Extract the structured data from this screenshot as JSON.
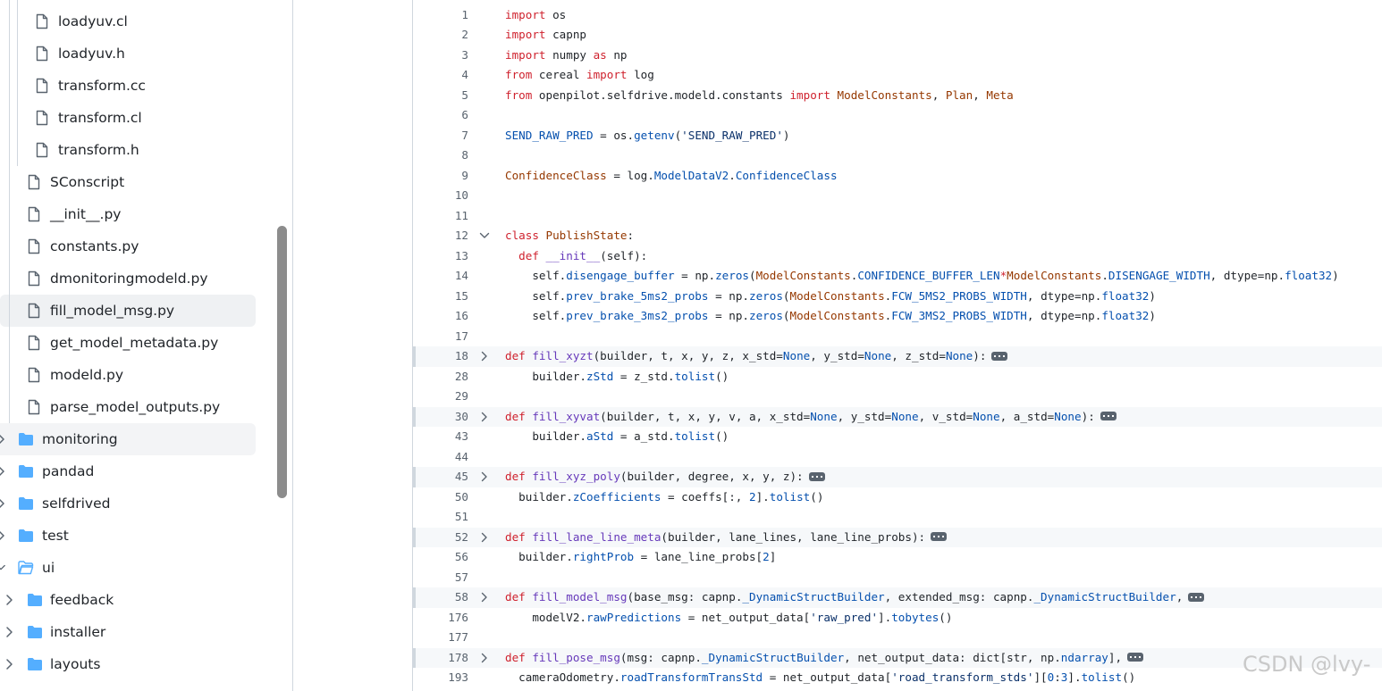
{
  "colors": {
    "folder": "#54aeff",
    "keyword": "#cf222e",
    "function": "#6639ba",
    "entity": "#0550ae",
    "class": "#953800",
    "string": "#0a3069"
  },
  "sidebar": {
    "items": [
      {
        "label": "loadyuv.cl",
        "type": "file",
        "depth": 2
      },
      {
        "label": "loadyuv.h",
        "type": "file",
        "depth": 2
      },
      {
        "label": "transform.cc",
        "type": "file",
        "depth": 2
      },
      {
        "label": "transform.cl",
        "type": "file",
        "depth": 2
      },
      {
        "label": "transform.h",
        "type": "file",
        "depth": 2
      },
      {
        "label": "SConscript",
        "type": "file",
        "depth": 1
      },
      {
        "label": "__init__.py",
        "type": "file",
        "depth": 1
      },
      {
        "label": "constants.py",
        "type": "file",
        "depth": 1
      },
      {
        "label": "dmonitoringmodeld.py",
        "type": "file",
        "depth": 1
      },
      {
        "label": "fill_model_msg.py",
        "type": "file",
        "depth": 1,
        "selected": true
      },
      {
        "label": "get_model_metadata.py",
        "type": "file",
        "depth": 1
      },
      {
        "label": "modeld.py",
        "type": "file",
        "depth": 1
      },
      {
        "label": "parse_model_outputs.py",
        "type": "file",
        "depth": 1
      },
      {
        "label": "monitoring",
        "type": "folder",
        "depth": 0,
        "hover": true
      },
      {
        "label": "pandad",
        "type": "folder",
        "depth": 0
      },
      {
        "label": "selfdrived",
        "type": "folder",
        "depth": 0
      },
      {
        "label": "test",
        "type": "folder",
        "depth": 0
      },
      {
        "label": "ui",
        "type": "folder-open",
        "depth": 0
      },
      {
        "label": "feedback",
        "type": "folder",
        "depth": 1
      },
      {
        "label": "installer",
        "type": "folder",
        "depth": 1
      },
      {
        "label": "layouts",
        "type": "folder",
        "depth": 1
      }
    ]
  },
  "code": {
    "lines": [
      {
        "n": "1",
        "t": [
          [
            "kw",
            "import"
          ],
          [
            "",
            "os"
          ]
        ]
      },
      {
        "n": "2",
        "t": [
          [
            "kw",
            "import"
          ],
          [
            "",
            "capnp"
          ]
        ]
      },
      {
        "n": "3",
        "t": [
          [
            "kw",
            "import"
          ],
          [
            "",
            "numpy "
          ],
          [
            "kw",
            "as"
          ],
          [
            "",
            "np"
          ]
        ]
      },
      {
        "n": "4",
        "t": [
          [
            "kw",
            "from"
          ],
          [
            "",
            "cereal "
          ],
          [
            "kw",
            "import"
          ],
          [
            "",
            "log"
          ]
        ]
      },
      {
        "n": "5",
        "t": [
          [
            "kw",
            "from"
          ],
          [
            "",
            "openpilot.selfdrive.modeld.constants "
          ],
          [
            "kw",
            "import"
          ],
          [
            "cls",
            "ModelConstants"
          ],
          [
            "",
            ", "
          ],
          [
            "cls",
            "Plan"
          ],
          [
            "",
            ", "
          ],
          [
            "cls",
            "Meta"
          ]
        ]
      },
      {
        "n": "6",
        "t": []
      },
      {
        "n": "7",
        "t": [
          [
            "ent",
            "SEND_RAW_PRED"
          ],
          [
            "",
            " = os."
          ],
          [
            "ent",
            "getenv"
          ],
          [
            "",
            "("
          ],
          [
            "str",
            "'SEND_RAW_PRED'"
          ],
          [
            "",
            ")"
          ]
        ]
      },
      {
        "n": "8",
        "t": []
      },
      {
        "n": "9",
        "t": [
          [
            "cls",
            "ConfidenceClass"
          ],
          [
            "",
            " = log."
          ],
          [
            "ent",
            "ModelDataV2"
          ],
          [
            "",
            "."
          ],
          [
            "ent",
            "ConfidenceClass"
          ]
        ]
      },
      {
        "n": "10",
        "t": []
      },
      {
        "n": "11",
        "t": []
      },
      {
        "n": "12",
        "fold": "open",
        "t": [
          [
            "kw",
            "class"
          ],
          [
            "cls",
            "PublishState"
          ],
          [
            "",
            ":"
          ]
        ]
      },
      {
        "n": "13",
        "t": [
          [
            "",
            "  "
          ],
          [
            "kw",
            "def"
          ],
          [
            "fn",
            "__init__"
          ],
          [
            "",
            "(self):"
          ]
        ]
      },
      {
        "n": "14",
        "t": [
          [
            "",
            "    self."
          ],
          [
            "ent",
            "disengage_buffer"
          ],
          [
            "",
            " = np."
          ],
          [
            "ent",
            "zeros"
          ],
          [
            "",
            "("
          ],
          [
            "cls",
            "ModelConstants"
          ],
          [
            "",
            "."
          ],
          [
            "ent",
            "CONFIDENCE_BUFFER_LEN"
          ],
          [
            "kw",
            "*"
          ],
          [
            "cls",
            "ModelConstants"
          ],
          [
            "",
            "."
          ],
          [
            "ent",
            "DISENGAGE_WIDTH"
          ],
          [
            "",
            ", dtype=np."
          ],
          [
            "ent",
            "float32"
          ],
          [
            "",
            ")"
          ]
        ]
      },
      {
        "n": "15",
        "t": [
          [
            "",
            "    self."
          ],
          [
            "ent",
            "prev_brake_5ms2_probs"
          ],
          [
            "",
            " = np."
          ],
          [
            "ent",
            "zeros"
          ],
          [
            "",
            "("
          ],
          [
            "cls",
            "ModelConstants"
          ],
          [
            "",
            "."
          ],
          [
            "ent",
            "FCW_5MS2_PROBS_WIDTH"
          ],
          [
            "",
            ", dtype=np."
          ],
          [
            "ent",
            "float32"
          ],
          [
            "",
            ")"
          ]
        ]
      },
      {
        "n": "16",
        "t": [
          [
            "",
            "    self."
          ],
          [
            "ent",
            "prev_brake_3ms2_probs"
          ],
          [
            "",
            " = np."
          ],
          [
            "ent",
            "zeros"
          ],
          [
            "",
            "("
          ],
          [
            "cls",
            "ModelConstants"
          ],
          [
            "",
            "."
          ],
          [
            "ent",
            "FCW_3MS2_PROBS_WIDTH"
          ],
          [
            "",
            ", dtype=np."
          ],
          [
            "ent",
            "float32"
          ],
          [
            "",
            ")"
          ]
        ]
      },
      {
        "n": "17",
        "t": []
      },
      {
        "n": "18",
        "fold": "closed",
        "t": [
          [
            "kw",
            "def"
          ],
          [
            "fn",
            "fill_xyzt"
          ],
          [
            "",
            "(builder, t, x, y, z, x_std="
          ],
          [
            "ent",
            "None"
          ],
          [
            "",
            ", y_std="
          ],
          [
            "ent",
            "None"
          ],
          [
            "",
            ", z_std="
          ],
          [
            "ent",
            "None"
          ],
          [
            "",
            "):"
          ]
        ]
      },
      {
        "n": "28",
        "t": [
          [
            "",
            "    builder."
          ],
          [
            "ent",
            "zStd"
          ],
          [
            "",
            " = z_std."
          ],
          [
            "ent",
            "tolist"
          ],
          [
            "",
            "()"
          ]
        ]
      },
      {
        "n": "29",
        "t": []
      },
      {
        "n": "30",
        "fold": "closed",
        "t": [
          [
            "kw",
            "def"
          ],
          [
            "fn",
            "fill_xyvat"
          ],
          [
            "",
            "(builder, t, x, y, v, a, x_std="
          ],
          [
            "ent",
            "None"
          ],
          [
            "",
            ", y_std="
          ],
          [
            "ent",
            "None"
          ],
          [
            "",
            ", v_std="
          ],
          [
            "ent",
            "None"
          ],
          [
            "",
            ", a_std="
          ],
          [
            "ent",
            "None"
          ],
          [
            "",
            "):"
          ]
        ]
      },
      {
        "n": "43",
        "t": [
          [
            "",
            "    builder."
          ],
          [
            "ent",
            "aStd"
          ],
          [
            "",
            " = a_std."
          ],
          [
            "ent",
            "tolist"
          ],
          [
            "",
            "()"
          ]
        ]
      },
      {
        "n": "44",
        "t": []
      },
      {
        "n": "45",
        "fold": "closed",
        "t": [
          [
            "kw",
            "def"
          ],
          [
            "fn",
            "fill_xyz_poly"
          ],
          [
            "",
            "(builder, degree, x, y, z):"
          ]
        ]
      },
      {
        "n": "50",
        "t": [
          [
            "",
            "  builder."
          ],
          [
            "ent",
            "zCoefficients"
          ],
          [
            "",
            " = coeffs[:, "
          ],
          [
            "num",
            "2"
          ],
          [
            "",
            "]."
          ],
          [
            "ent",
            "tolist"
          ],
          [
            "",
            "()"
          ]
        ]
      },
      {
        "n": "51",
        "t": []
      },
      {
        "n": "52",
        "fold": "closed",
        "t": [
          [
            "kw",
            "def"
          ],
          [
            "fn",
            "fill_lane_line_meta"
          ],
          [
            "",
            "(builder, lane_lines, lane_line_probs):"
          ]
        ]
      },
      {
        "n": "56",
        "t": [
          [
            "",
            "  builder."
          ],
          [
            "ent",
            "rightProb"
          ],
          [
            "",
            " = lane_line_probs["
          ],
          [
            "num",
            "2"
          ],
          [
            "",
            "]"
          ]
        ]
      },
      {
        "n": "57",
        "t": []
      },
      {
        "n": "58",
        "fold": "closed",
        "t": [
          [
            "kw",
            "def"
          ],
          [
            "fn",
            "fill_model_msg"
          ],
          [
            "",
            "(base_msg: capnp."
          ],
          [
            "ent",
            "_DynamicStructBuilder"
          ],
          [
            "",
            ", extended_msg: capnp."
          ],
          [
            "ent",
            "_DynamicStructBuilder"
          ],
          [
            "",
            ","
          ]
        ]
      },
      {
        "n": "176",
        "t": [
          [
            "",
            "    modelV2."
          ],
          [
            "ent",
            "rawPredictions"
          ],
          [
            "",
            " = net_output_data["
          ],
          [
            "str",
            "'raw_pred'"
          ],
          [
            "",
            "]."
          ],
          [
            "ent",
            "tobytes"
          ],
          [
            "",
            "()"
          ]
        ]
      },
      {
        "n": "177",
        "t": []
      },
      {
        "n": "178",
        "fold": "closed",
        "t": [
          [
            "kw",
            "def"
          ],
          [
            "fn",
            "fill_pose_msg"
          ],
          [
            "",
            "(msg: capnp."
          ],
          [
            "ent",
            "_DynamicStructBuilder"
          ],
          [
            "",
            ", net_output_data: dict[str, np."
          ],
          [
            "ent",
            "ndarray"
          ],
          [
            "",
            "],"
          ]
        ]
      },
      {
        "n": "193",
        "t": [
          [
            "",
            "  cameraOdometry."
          ],
          [
            "ent",
            "roadTransformTransStd"
          ],
          [
            "",
            " = net_output_data["
          ],
          [
            "str",
            "'road_transform_stds'"
          ],
          [
            "",
            "]["
          ],
          [
            "num",
            "0"
          ],
          [
            "",
            ":"
          ],
          [
            "num",
            "3"
          ],
          [
            "",
            "]."
          ],
          [
            "ent",
            "tolist"
          ],
          [
            "",
            "()"
          ]
        ]
      }
    ]
  },
  "watermark": "CSDN @lvy-"
}
